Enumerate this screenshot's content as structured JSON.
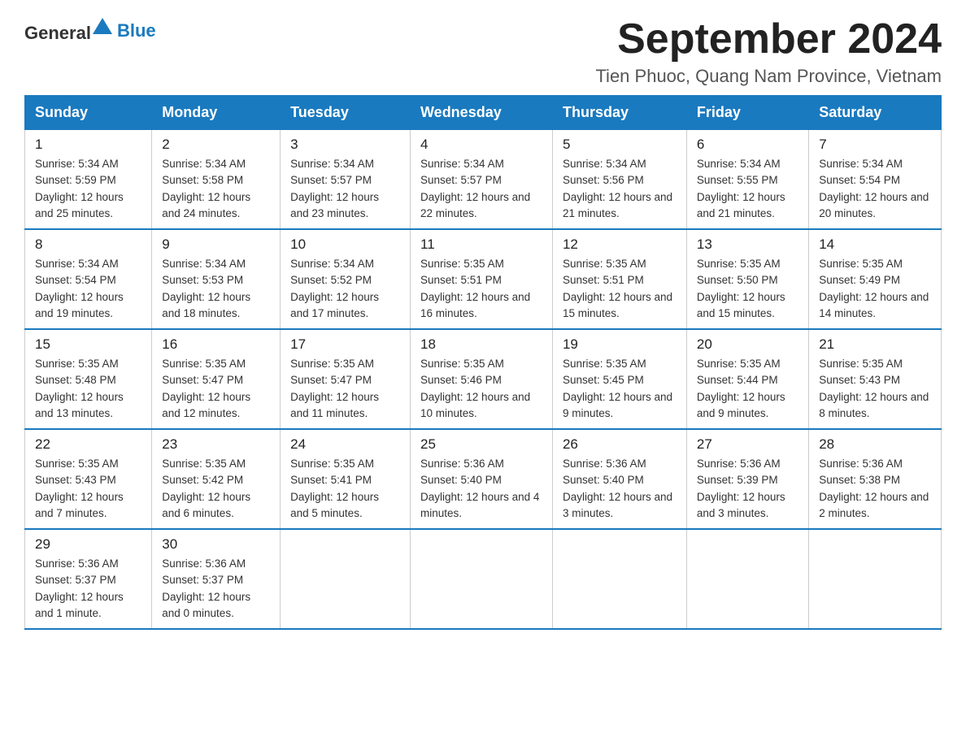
{
  "header": {
    "logo_general": "General",
    "logo_blue": "Blue",
    "month_title": "September 2024",
    "location": "Tien Phuoc, Quang Nam Province, Vietnam"
  },
  "days_of_week": [
    "Sunday",
    "Monday",
    "Tuesday",
    "Wednesday",
    "Thursday",
    "Friday",
    "Saturday"
  ],
  "weeks": [
    [
      {
        "day": "1",
        "sunrise": "5:34 AM",
        "sunset": "5:59 PM",
        "daylight": "12 hours and 25 minutes."
      },
      {
        "day": "2",
        "sunrise": "5:34 AM",
        "sunset": "5:58 PM",
        "daylight": "12 hours and 24 minutes."
      },
      {
        "day": "3",
        "sunrise": "5:34 AM",
        "sunset": "5:57 PM",
        "daylight": "12 hours and 23 minutes."
      },
      {
        "day": "4",
        "sunrise": "5:34 AM",
        "sunset": "5:57 PM",
        "daylight": "12 hours and 22 minutes."
      },
      {
        "day": "5",
        "sunrise": "5:34 AM",
        "sunset": "5:56 PM",
        "daylight": "12 hours and 21 minutes."
      },
      {
        "day": "6",
        "sunrise": "5:34 AM",
        "sunset": "5:55 PM",
        "daylight": "12 hours and 21 minutes."
      },
      {
        "day": "7",
        "sunrise": "5:34 AM",
        "sunset": "5:54 PM",
        "daylight": "12 hours and 20 minutes."
      }
    ],
    [
      {
        "day": "8",
        "sunrise": "5:34 AM",
        "sunset": "5:54 PM",
        "daylight": "12 hours and 19 minutes."
      },
      {
        "day": "9",
        "sunrise": "5:34 AM",
        "sunset": "5:53 PM",
        "daylight": "12 hours and 18 minutes."
      },
      {
        "day": "10",
        "sunrise": "5:34 AM",
        "sunset": "5:52 PM",
        "daylight": "12 hours and 17 minutes."
      },
      {
        "day": "11",
        "sunrise": "5:35 AM",
        "sunset": "5:51 PM",
        "daylight": "12 hours and 16 minutes."
      },
      {
        "day": "12",
        "sunrise": "5:35 AM",
        "sunset": "5:51 PM",
        "daylight": "12 hours and 15 minutes."
      },
      {
        "day": "13",
        "sunrise": "5:35 AM",
        "sunset": "5:50 PM",
        "daylight": "12 hours and 15 minutes."
      },
      {
        "day": "14",
        "sunrise": "5:35 AM",
        "sunset": "5:49 PM",
        "daylight": "12 hours and 14 minutes."
      }
    ],
    [
      {
        "day": "15",
        "sunrise": "5:35 AM",
        "sunset": "5:48 PM",
        "daylight": "12 hours and 13 minutes."
      },
      {
        "day": "16",
        "sunrise": "5:35 AM",
        "sunset": "5:47 PM",
        "daylight": "12 hours and 12 minutes."
      },
      {
        "day": "17",
        "sunrise": "5:35 AM",
        "sunset": "5:47 PM",
        "daylight": "12 hours and 11 minutes."
      },
      {
        "day": "18",
        "sunrise": "5:35 AM",
        "sunset": "5:46 PM",
        "daylight": "12 hours and 10 minutes."
      },
      {
        "day": "19",
        "sunrise": "5:35 AM",
        "sunset": "5:45 PM",
        "daylight": "12 hours and 9 minutes."
      },
      {
        "day": "20",
        "sunrise": "5:35 AM",
        "sunset": "5:44 PM",
        "daylight": "12 hours and 9 minutes."
      },
      {
        "day": "21",
        "sunrise": "5:35 AM",
        "sunset": "5:43 PM",
        "daylight": "12 hours and 8 minutes."
      }
    ],
    [
      {
        "day": "22",
        "sunrise": "5:35 AM",
        "sunset": "5:43 PM",
        "daylight": "12 hours and 7 minutes."
      },
      {
        "day": "23",
        "sunrise": "5:35 AM",
        "sunset": "5:42 PM",
        "daylight": "12 hours and 6 minutes."
      },
      {
        "day": "24",
        "sunrise": "5:35 AM",
        "sunset": "5:41 PM",
        "daylight": "12 hours and 5 minutes."
      },
      {
        "day": "25",
        "sunrise": "5:36 AM",
        "sunset": "5:40 PM",
        "daylight": "12 hours and 4 minutes."
      },
      {
        "day": "26",
        "sunrise": "5:36 AM",
        "sunset": "5:40 PM",
        "daylight": "12 hours and 3 minutes."
      },
      {
        "day": "27",
        "sunrise": "5:36 AM",
        "sunset": "5:39 PM",
        "daylight": "12 hours and 3 minutes."
      },
      {
        "day": "28",
        "sunrise": "5:36 AM",
        "sunset": "5:38 PM",
        "daylight": "12 hours and 2 minutes."
      }
    ],
    [
      {
        "day": "29",
        "sunrise": "5:36 AM",
        "sunset": "5:37 PM",
        "daylight": "12 hours and 1 minute."
      },
      {
        "day": "30",
        "sunrise": "5:36 AM",
        "sunset": "5:37 PM",
        "daylight": "12 hours and 0 minutes."
      },
      null,
      null,
      null,
      null,
      null
    ]
  ]
}
